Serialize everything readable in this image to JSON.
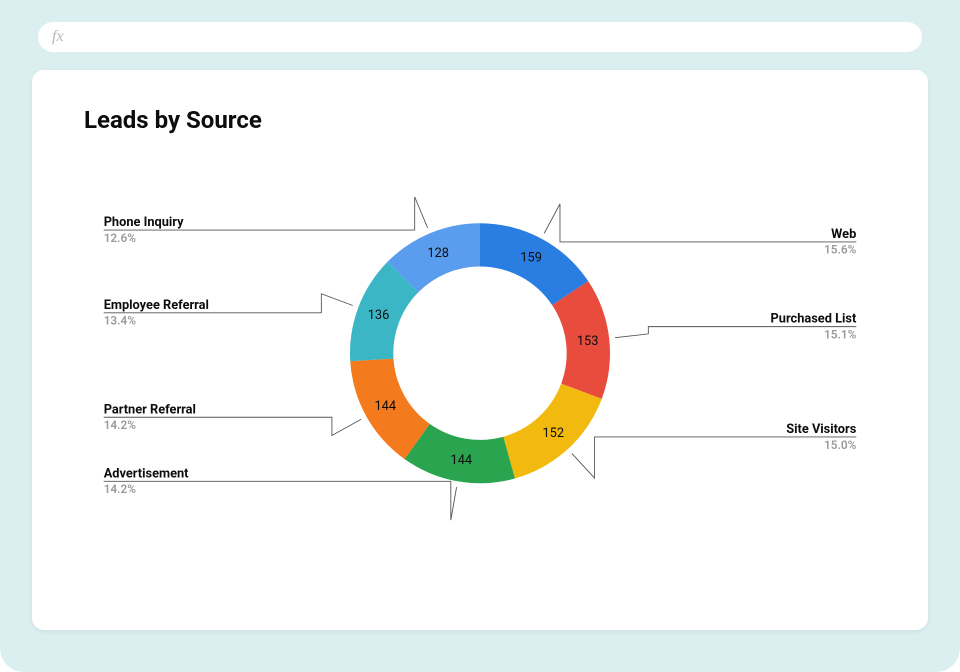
{
  "formula_bar": {
    "text": "fx"
  },
  "title": "Leads by Source",
  "chart_data": {
    "type": "pie",
    "title": "Leads by Source",
    "slices": [
      {
        "label": "Web",
        "value": 159,
        "pct": "15.6%",
        "color": "#2a7de1"
      },
      {
        "label": "Purchased List",
        "value": 153,
        "pct": "15.1%",
        "color": "#e84c3d"
      },
      {
        "label": "Site Visitors",
        "value": 152,
        "pct": "15.0%",
        "color": "#f2b90f"
      },
      {
        "label": "Advertisement",
        "value": 144,
        "pct": "14.2%",
        "color": "#2aa44f"
      },
      {
        "label": "Partner Referral",
        "value": 144,
        "pct": "14.2%",
        "color": "#f37b1d"
      },
      {
        "label": "Employee Referral",
        "value": 136,
        "pct": "13.4%",
        "color": "#3bb6c4"
      },
      {
        "label": "Phone Inquiry",
        "value": 128,
        "pct": "12.6%",
        "color": "#5a9ced"
      }
    ]
  }
}
